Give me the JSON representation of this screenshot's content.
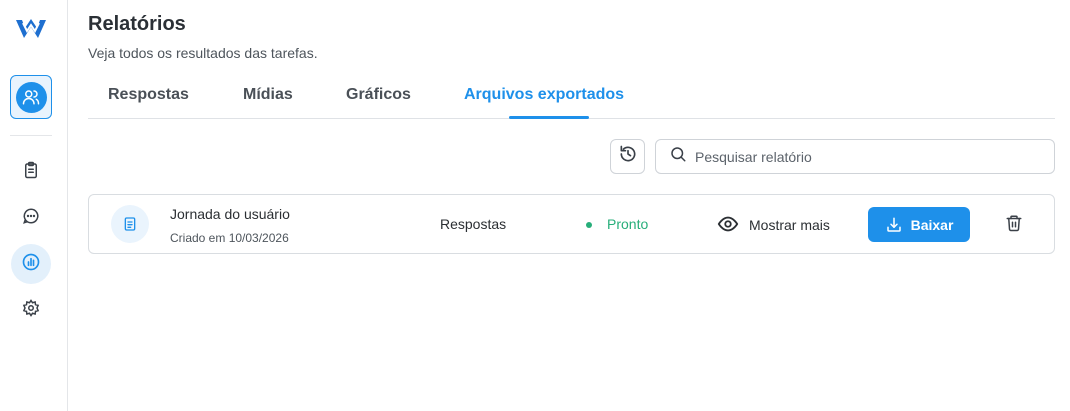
{
  "header": {
    "title": "Relatórios",
    "subtitle": "Veja todos os resultados das tarefas."
  },
  "tabs": [
    {
      "label": "Respostas",
      "active": false
    },
    {
      "label": "Mídias",
      "active": false
    },
    {
      "label": "Gráficos",
      "active": false
    },
    {
      "label": "Arquivos exportados",
      "active": true
    }
  ],
  "search": {
    "placeholder": "Pesquisar relatório"
  },
  "sidebar": {
    "items": [
      {
        "icon": "team-icon",
        "active": true
      },
      {
        "icon": "clipboard-icon",
        "active": false
      },
      {
        "icon": "chat-icon",
        "active": false
      },
      {
        "icon": "chart-icon",
        "active": true
      },
      {
        "icon": "gear-icon",
        "active": false
      }
    ]
  },
  "reports": [
    {
      "name": "Jornada do usuário",
      "created": "Criado em 10/03/2026",
      "type": "Respostas",
      "status": "Pronto",
      "show_more_label": "Mostrar mais",
      "download_label": "Baixar"
    }
  ],
  "colors": {
    "accent": "#1e90ea",
    "status_ready": "#27ae7a"
  }
}
